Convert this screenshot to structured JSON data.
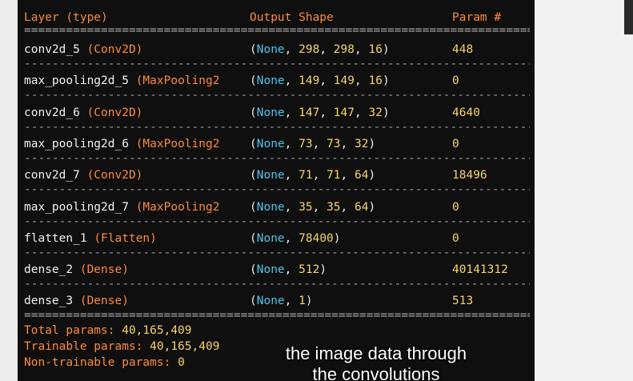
{
  "header": {
    "layer": "Layer (type)",
    "output_shape": "Output Shape",
    "param": "Param #"
  },
  "separator_eq": "================================================================================",
  "separator_dash": "--------------------------------------------------------------------------------",
  "layers": [
    {
      "name": "conv2d_5 ",
      "type": "(Conv2D)",
      "shape": [
        "298",
        "298",
        "16"
      ],
      "param": "448"
    },
    {
      "name": "max_pooling2d_5 ",
      "type": "(MaxPooling2",
      "shape": [
        "149",
        "149",
        "16"
      ],
      "param": "0"
    },
    {
      "name": "conv2d_6 ",
      "type": "(Conv2D)",
      "shape": [
        "147",
        "147",
        "32"
      ],
      "param": "4640"
    },
    {
      "name": "max_pooling2d_6 ",
      "type": "(MaxPooling2",
      "shape": [
        "73",
        "73",
        "32"
      ],
      "param": "0"
    },
    {
      "name": "conv2d_7 ",
      "type": "(Conv2D)",
      "shape": [
        "71",
        "71",
        "64"
      ],
      "param": "18496"
    },
    {
      "name": "max_pooling2d_7 ",
      "type": "(MaxPooling2",
      "shape": [
        "35",
        "35",
        "64"
      ],
      "param": "0"
    },
    {
      "name": "flatten_1 ",
      "type": "(Flatten)",
      "shape": [
        "78400"
      ],
      "param": "0"
    },
    {
      "name": "dense_2 ",
      "type": "(Dense)",
      "shape": [
        "512"
      ],
      "param": "40141312"
    },
    {
      "name": "dense_3 ",
      "type": "(Dense)",
      "shape": [
        "1"
      ],
      "param": "513"
    }
  ],
  "totals": [
    {
      "label": "Total params: ",
      "value": "40,165,409"
    },
    {
      "label": "Trainable params: ",
      "value": "40,165,409"
    },
    {
      "label": "Non-trainable params: ",
      "value": "0"
    }
  ],
  "caption": {
    "line1": "the image data through",
    "line2": "the convolutions"
  },
  "colors": {
    "background": "#0f0f0f",
    "orange": "#ff8a3c",
    "cyan": "#4fc4e8",
    "yellow": "#f5d36a",
    "white": "#f0f0f0"
  }
}
